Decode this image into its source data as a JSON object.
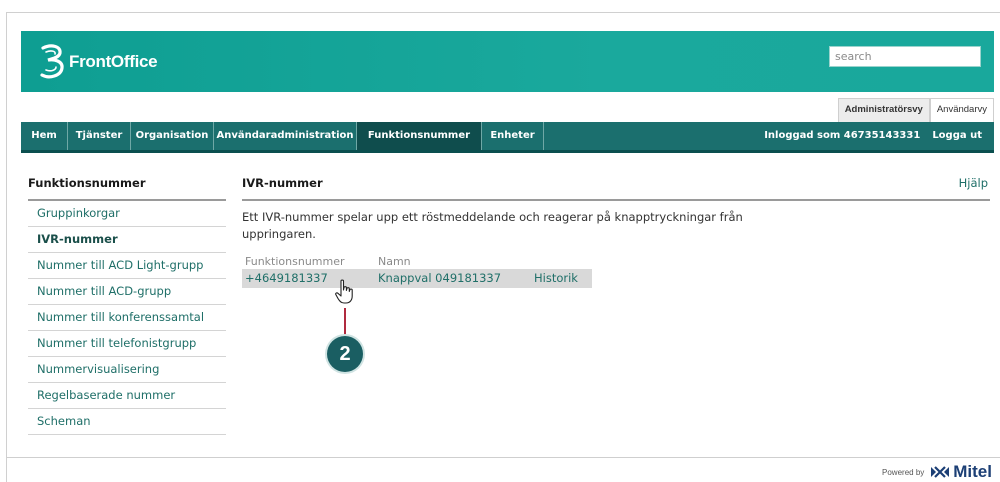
{
  "brand": {
    "logo_text": "FrontOffice",
    "logo_color": "#ffffff",
    "banner_color": "#14a498"
  },
  "search": {
    "placeholder": "search"
  },
  "view_tabs": [
    {
      "label": "Administratörsvy",
      "active": true
    },
    {
      "label": "Användarvy",
      "active": false
    }
  ],
  "nav": {
    "items": [
      {
        "label": "Hem",
        "active": false
      },
      {
        "label": "Tjänster",
        "active": false
      },
      {
        "label": "Organisation",
        "active": false
      },
      {
        "label": "Användaradministration",
        "active": false
      },
      {
        "label": "Funktionsnummer",
        "active": true
      },
      {
        "label": "Enheter",
        "active": false
      }
    ],
    "logged_in": "Inloggad som 46735143331",
    "logout": "Logga ut",
    "bg_color": "#1b6f6e"
  },
  "sidebar": {
    "title": "Funktionsnummer",
    "items": [
      {
        "label": "Gruppinkorgar",
        "active": false
      },
      {
        "label": "IVR-nummer",
        "active": true
      },
      {
        "label": "Nummer till ACD Light-grupp",
        "active": false
      },
      {
        "label": "Nummer till ACD-grupp",
        "active": false
      },
      {
        "label": "Nummer till konferenssamtal",
        "active": false
      },
      {
        "label": "Nummer till telefonistgrupp",
        "active": false
      },
      {
        "label": "Nummervisualisering",
        "active": false
      },
      {
        "label": "Regelbaserade nummer",
        "active": false
      },
      {
        "label": "Scheman",
        "active": false
      }
    ]
  },
  "main": {
    "title": "IVR-nummer",
    "help": "Hjälp",
    "description": "Ett IVR-nummer spelar upp ett röstmeddelande och reagerar på knapptryckningar från uppringaren.",
    "table": {
      "headers": [
        "Funktionsnummer",
        "Namn"
      ],
      "rows": [
        {
          "number": "+4649181337",
          "name": "Knappval 049181337",
          "action": "Historik"
        }
      ]
    }
  },
  "callout": {
    "label": "2",
    "color": "#1a5e62",
    "line_color": "#b02a3f"
  },
  "footer": {
    "powered_by": "Powered by",
    "vendor": "Mitel"
  },
  "icons": [
    "frontoffice-logo-icon",
    "hand-pointer-icon",
    "mitel-logo-icon"
  ]
}
